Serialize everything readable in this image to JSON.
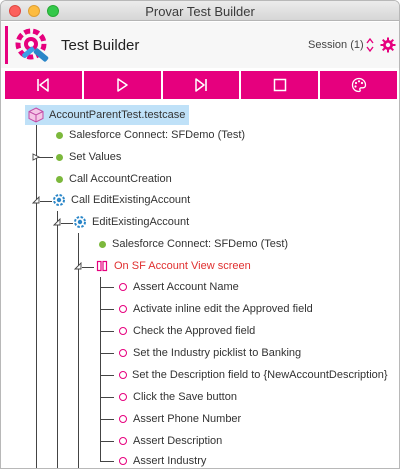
{
  "window": {
    "title": "Provar Test Builder"
  },
  "header": {
    "title": "Test Builder",
    "session_label": "Session (1)"
  },
  "toolbar": {
    "buttons": [
      "step-back",
      "play",
      "step-forward",
      "stop",
      "palette"
    ]
  },
  "colors": {
    "accent": "#e6007e",
    "success": "#7cb83c",
    "selection": "#bfe1f8",
    "error_text": "#e03030"
  },
  "tree": {
    "root": "AccountParentTest.testcase",
    "items": [
      "Salesforce Connect: SFDemo (Test)",
      "Set Values",
      "Call AccountCreation",
      "Call EditExistingAccount",
      "EditExistingAccount",
      "Salesforce Connect: SFDemo (Test)",
      "On SF Account View screen",
      "Assert Account Name",
      "Activate inline edit the Approved field",
      "Check the Approved field",
      "Set the Industry picklist to Banking",
      "Set the Description field to {NewAccountDescription}",
      "Click the Save button",
      "Assert Phone Number",
      "Assert Description",
      "Assert Industry"
    ]
  }
}
